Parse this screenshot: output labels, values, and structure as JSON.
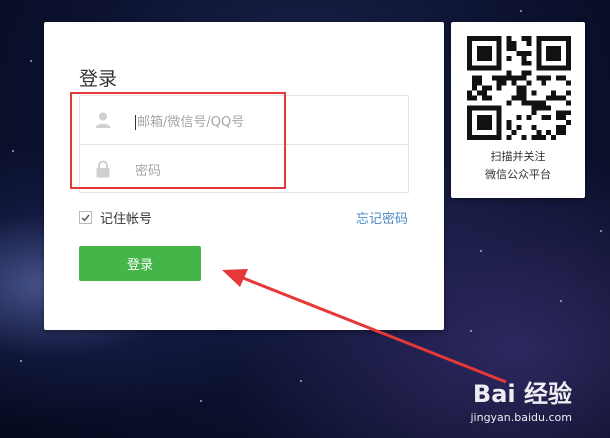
{
  "login": {
    "title": "登录",
    "account_placeholder": "邮箱/微信号/QQ号",
    "password_placeholder": "密码",
    "remember_label": "记住帐号",
    "remember_checked": true,
    "forgot_label": "忘记密码",
    "login_button": "登录"
  },
  "qr": {
    "line1": "扫描并关注",
    "line2": "微信公众平台"
  },
  "watermark": {
    "logo": "Bai 经验",
    "url": "jingyan.baidu.com"
  },
  "colors": {
    "primary_button": "#44b549",
    "link": "#4a8bc2",
    "annotation": "#e53838"
  },
  "icons": {
    "user": "user-icon",
    "lock": "lock-icon",
    "check": "check-icon",
    "qr": "qr-code"
  }
}
